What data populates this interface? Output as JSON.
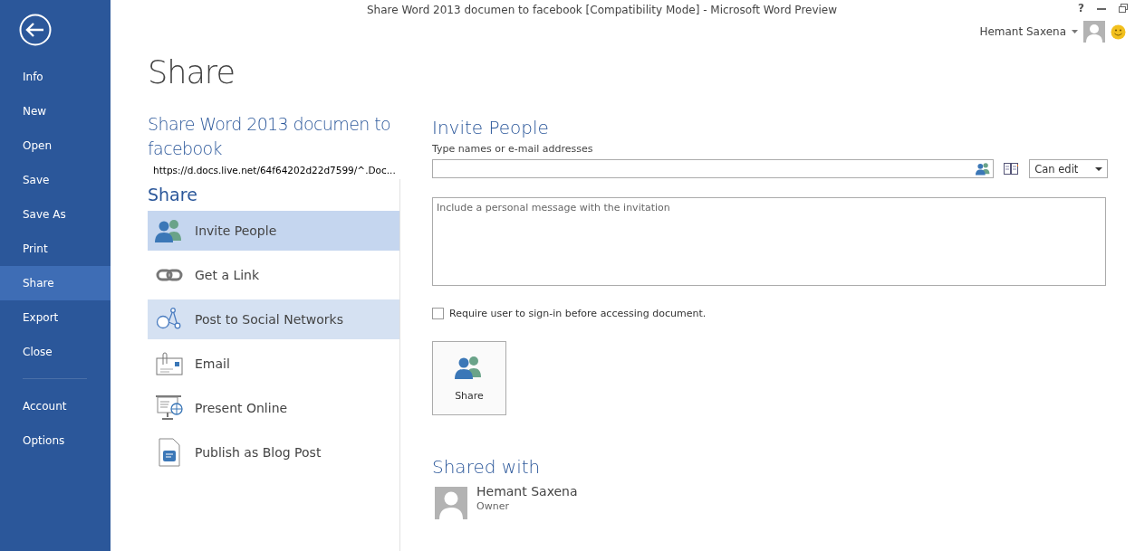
{
  "window": {
    "title": "Share Word 2013 documen to facebook [Compatibility Mode] - Microsoft Word Preview",
    "controls": [
      "?"
    ],
    "user": "Hemant Saxena"
  },
  "sidebar": {
    "items": [
      {
        "label": "Info",
        "selected": false
      },
      {
        "label": "New",
        "selected": false
      },
      {
        "label": "Open",
        "selected": false
      },
      {
        "label": "Save",
        "selected": false
      },
      {
        "label": "Save As",
        "selected": false
      },
      {
        "label": "Print",
        "selected": false
      },
      {
        "label": "Share",
        "selected": true
      },
      {
        "label": "Export",
        "selected": false
      },
      {
        "label": "Close",
        "selected": false
      },
      {
        "label": "Account",
        "selected": false,
        "kind": "lower"
      },
      {
        "label": "Options",
        "selected": false,
        "kind": "lower"
      }
    ]
  },
  "page_title": "Share",
  "document": {
    "title": "Share Word 2013 documen to facebook",
    "url": "https://d.docs.live.net/64f64202d22d7599/^.Doc..."
  },
  "share": {
    "heading": "Share",
    "options": [
      {
        "label": "Invite People",
        "kind": "people",
        "selected": true,
        "hovered": false
      },
      {
        "label": "Get a Link",
        "kind": "link",
        "selected": false,
        "hovered": false
      },
      {
        "label": "Post to Social Networks",
        "kind": "network",
        "selected": false,
        "hovered": true
      },
      {
        "label": "Email",
        "kind": "email",
        "selected": false,
        "hovered": false
      },
      {
        "label": "Present Online",
        "kind": "present",
        "selected": false,
        "hovered": false
      },
      {
        "label": "Publish as Blog Post",
        "kind": "blog",
        "selected": false,
        "hovered": false
      }
    ]
  },
  "invite": {
    "heading": "Invite People",
    "names_label": "Type names or e-mail addresses",
    "permission": "Can edit",
    "message_placeholder": "Include a personal message with the invitation",
    "require_signin": {
      "label": "Require user to sign-in before accessing document.",
      "checked": false
    },
    "share_button": "Share"
  },
  "shared_with": {
    "heading": "Shared with",
    "people": [
      {
        "name": "Hemant Saxena",
        "role": "Owner"
      }
    ]
  }
}
